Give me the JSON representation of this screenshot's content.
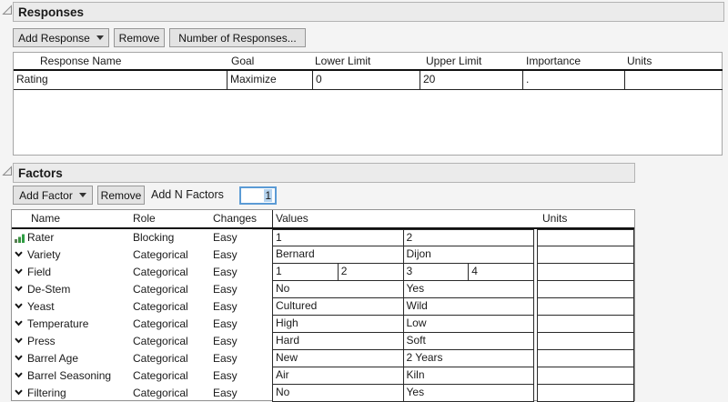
{
  "colors": {
    "accent_blue": "#5b9bd5",
    "selection_blue": "#b5d3ee",
    "icon_green": "#2f9e44",
    "panel_gray": "#ebebeb"
  },
  "panels": {
    "responses": {
      "title": "Responses",
      "toolbar": {
        "add_button": "Add Response",
        "remove_button": "Remove",
        "number_button": "Number of Responses..."
      },
      "table": {
        "columns": [
          "Response Name",
          "Goal",
          "Lower Limit",
          "Upper Limit",
          "Importance",
          "Units"
        ],
        "rows": [
          {
            "name": "Rating",
            "goal": "Maximize",
            "lower": "0",
            "upper": "20",
            "importance": ".",
            "units": ""
          }
        ]
      }
    },
    "factors": {
      "title": "Factors",
      "toolbar": {
        "add_button": "Add Factor",
        "remove_button": "Remove",
        "add_n_label": "Add N Factors",
        "add_n_value": "1"
      },
      "table": {
        "columns": [
          "Name",
          "Role",
          "Changes",
          "Values",
          "Units"
        ],
        "rows": [
          {
            "icon": "blocking-icon",
            "name": "Rater",
            "role": "Blocking",
            "changes": "Easy",
            "values": [
              "1",
              "2"
            ],
            "units": ""
          },
          {
            "icon": "chevron-down-icon",
            "name": "Variety",
            "role": "Categorical",
            "changes": "Easy",
            "values": [
              "Bernard",
              "Dijon"
            ],
            "units": ""
          },
          {
            "icon": "chevron-down-icon",
            "name": "Field",
            "role": "Categorical",
            "changes": "Easy",
            "values": [
              "1",
              "2",
              "3",
              "4"
            ],
            "units": ""
          },
          {
            "icon": "chevron-down-icon",
            "name": "De-Stem",
            "role": "Categorical",
            "changes": "Easy",
            "values": [
              "No",
              "Yes"
            ],
            "units": ""
          },
          {
            "icon": "chevron-down-icon",
            "name": "Yeast",
            "role": "Categorical",
            "changes": "Easy",
            "values": [
              "Cultured",
              "Wild"
            ],
            "units": ""
          },
          {
            "icon": "chevron-down-icon",
            "name": "Temperature",
            "role": "Categorical",
            "changes": "Easy",
            "values": [
              "High",
              "Low"
            ],
            "units": ""
          },
          {
            "icon": "chevron-down-icon",
            "name": "Press",
            "role": "Categorical",
            "changes": "Easy",
            "values": [
              "Hard",
              "Soft"
            ],
            "units": ""
          },
          {
            "icon": "chevron-down-icon",
            "name": "Barrel Age",
            "role": "Categorical",
            "changes": "Easy",
            "values": [
              "New",
              "2 Years"
            ],
            "units": ""
          },
          {
            "icon": "chevron-down-icon",
            "name": "Barrel Seasoning",
            "role": "Categorical",
            "changes": "Easy",
            "values": [
              "Air",
              "Kiln"
            ],
            "units": ""
          },
          {
            "icon": "chevron-down-icon",
            "name": "Filtering",
            "role": "Categorical",
            "changes": "Easy",
            "values": [
              "No",
              "Yes"
            ],
            "units": ""
          }
        ]
      }
    }
  }
}
